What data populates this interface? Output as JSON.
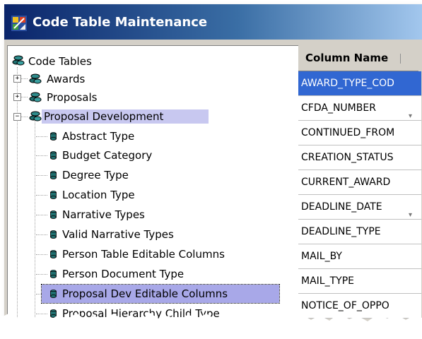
{
  "window": {
    "title": "Code Table Maintenance"
  },
  "tree": {
    "root": {
      "label": "Code Tables",
      "icon": "database-icon"
    },
    "groups": [
      {
        "label": "Awards",
        "expanded": false
      },
      {
        "label": "Proposals",
        "expanded": false
      },
      {
        "label": "Proposal Development",
        "expanded": true,
        "selected": true
      }
    ],
    "children": [
      {
        "label": "Abstract Type"
      },
      {
        "label": "Budget Category"
      },
      {
        "label": "Degree Type"
      },
      {
        "label": "Location Type"
      },
      {
        "label": "Narrative Types"
      },
      {
        "label": "Valid Narrative Types"
      },
      {
        "label": "Person Table Editable Columns"
      },
      {
        "label": "Person Document Type"
      },
      {
        "label": "Proposal Dev Editable Columns",
        "focused": true
      },
      {
        "label": "Proposal Hierarchy Child Type"
      }
    ]
  },
  "grid": {
    "header": "Column Name",
    "rows": [
      {
        "value": "AWARD_TYPE_COD",
        "selected": true
      },
      {
        "value": "CFDA_NUMBER"
      },
      {
        "value": "CONTINUED_FROM"
      },
      {
        "value": "CREATION_STATUS"
      },
      {
        "value": "CURRENT_AWARD"
      },
      {
        "value": "DEADLINE_DATE"
      },
      {
        "value": "DEADLINE_TYPE"
      },
      {
        "value": "MAIL_BY"
      },
      {
        "value": "MAIL_TYPE"
      },
      {
        "value": "NOTICE_OF_OPPO"
      }
    ]
  },
  "colors": {
    "title_gradient_start": "#0a246a",
    "title_gradient_end": "#a6caf0",
    "tree_selection": "#c8c8f0",
    "grid_selection": "#3167d2"
  }
}
